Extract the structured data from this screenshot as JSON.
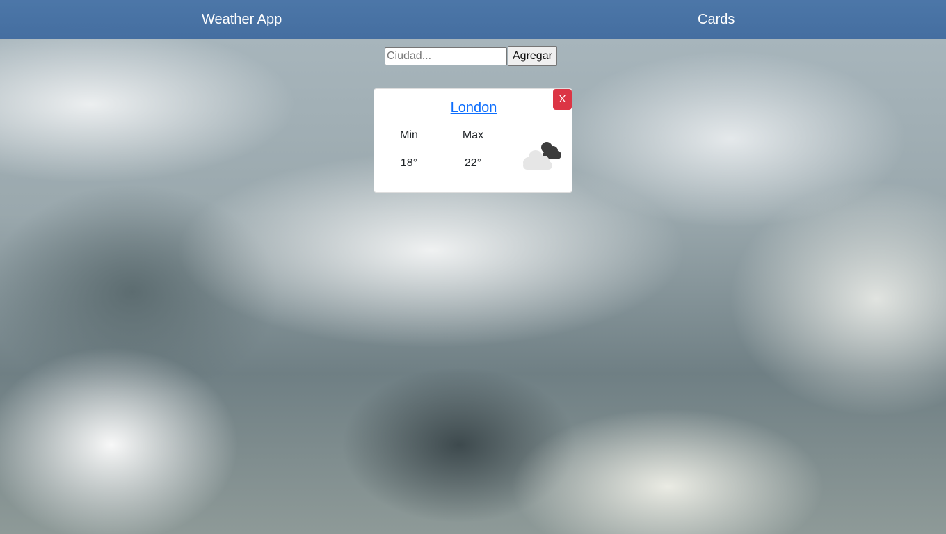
{
  "header": {
    "brand": "Weather App",
    "nav_link": "Cards"
  },
  "search": {
    "placeholder": "Ciudad...",
    "value": "",
    "button_label": "Agregar"
  },
  "cards": [
    {
      "city": "London",
      "close_label": "X",
      "min_label": "Min",
      "min_value": "18°",
      "max_label": "Max",
      "max_value": "22°",
      "icon": "broken-clouds-icon"
    }
  ],
  "colors": {
    "header": "#4471a6",
    "close_button": "#dc3545",
    "city_link": "#0d6efd"
  }
}
